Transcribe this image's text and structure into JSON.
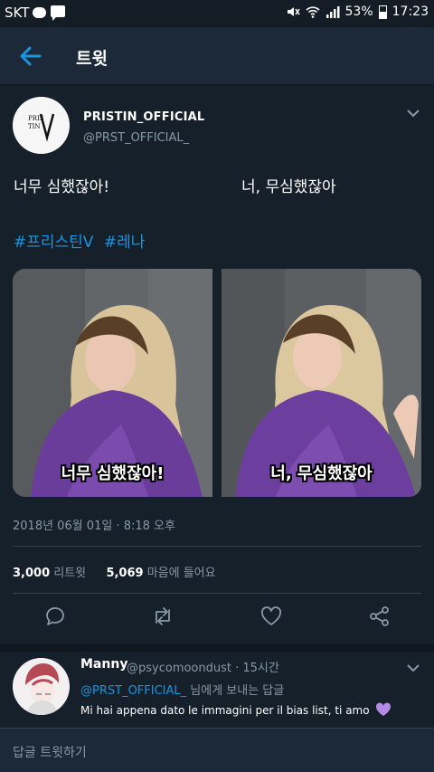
{
  "status_bar": {
    "carrier": "SKT",
    "battery": "53%",
    "time": "17:23",
    "icons": [
      "talk-bubble-icon",
      "message-icon",
      "mute-icon",
      "wifi-icon",
      "signal-icon",
      "battery-icon"
    ]
  },
  "header": {
    "title": "트윗",
    "back_icon": "arrow-left-icon",
    "accent": "#1b95e0"
  },
  "tweet": {
    "avatar_text": "PRISTIN V",
    "display_name": "PRISTIN_OFFICIAL",
    "handle": "@PRST_OFFICIAL_",
    "text_line1": "너무 심했잖아!",
    "text_line2": "너, 무심했잖아",
    "hashtags": [
      "#프리스틴V",
      "#레나"
    ],
    "photos": [
      {
        "caption": "너무 심했잖아!"
      },
      {
        "caption": "너, 무심했잖아"
      }
    ],
    "timestamp": "2018년 06월 01일 · 8:18 오후",
    "retweets_count": "3,000",
    "retweets_label": "리트윗",
    "likes_count": "5,069",
    "likes_label": "마음에 들어요",
    "actions": [
      "reply-icon",
      "retweet-icon",
      "like-icon",
      "share-icon"
    ]
  },
  "reply": {
    "name": "Manny",
    "meta": "@psycomoondust · 15시간",
    "reply_to_mention": "@PRST_OFFICIAL_",
    "reply_to_suffix": " 님에게 보내는 답글",
    "text": "Mi hai appena dato le immagini per il bias list, ti amo",
    "emoji": "purple-heart-icon"
  },
  "compose": {
    "placeholder": "답글 트윗하기"
  },
  "colors": {
    "background": "#15202b",
    "header": "#1c2938",
    "secondary_text": "#8899a6",
    "link": "#1b95e0",
    "purple_heart": "#b58ae6"
  }
}
